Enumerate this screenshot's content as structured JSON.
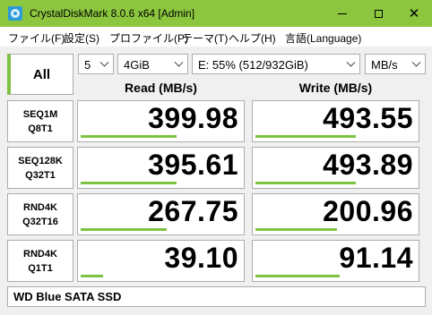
{
  "window": {
    "title": "CrystalDiskMark 8.0.6 x64 [Admin]",
    "title_bar_color": "#8cc63f",
    "icons": {
      "minimize": "minimize-icon",
      "maximize": "maximize-icon",
      "close": "close-icon"
    },
    "close_glyph": "✕"
  },
  "menu": [
    "ファイル(F)",
    "設定(S)",
    "プロファイル(P)",
    "テーマ(T)",
    "ヘルプ(H)",
    "言語(Language)"
  ],
  "controls": {
    "all_label": "All",
    "count": "5",
    "size": "4GiB",
    "drive": "E: 55% (512/932GiB)",
    "unit": "MB/s"
  },
  "headers": {
    "read": "Read (MB/s)",
    "write": "Write (MB/s)"
  },
  "accent_color": "#7dc242",
  "tests": [
    {
      "line1": "SEQ1M",
      "line2": "Q8T1",
      "read": "399.98",
      "write": "493.55",
      "read_fill": 0.59,
      "write_fill": 0.62
    },
    {
      "line1": "SEQ128K",
      "line2": "Q32T1",
      "read": "395.61",
      "write": "493.89",
      "read_fill": 0.59,
      "write_fill": 0.62
    },
    {
      "line1": "RND4K",
      "line2": "Q32T16",
      "read": "267.75",
      "write": "200.96",
      "read_fill": 0.53,
      "write_fill": 0.5
    },
    {
      "line1": "RND4K",
      "line2": "Q1T1",
      "read": "39.10",
      "write": "91.14",
      "read_fill": 0.14,
      "write_fill": 0.52
    }
  ],
  "comment": "WD Blue SATA SSD"
}
